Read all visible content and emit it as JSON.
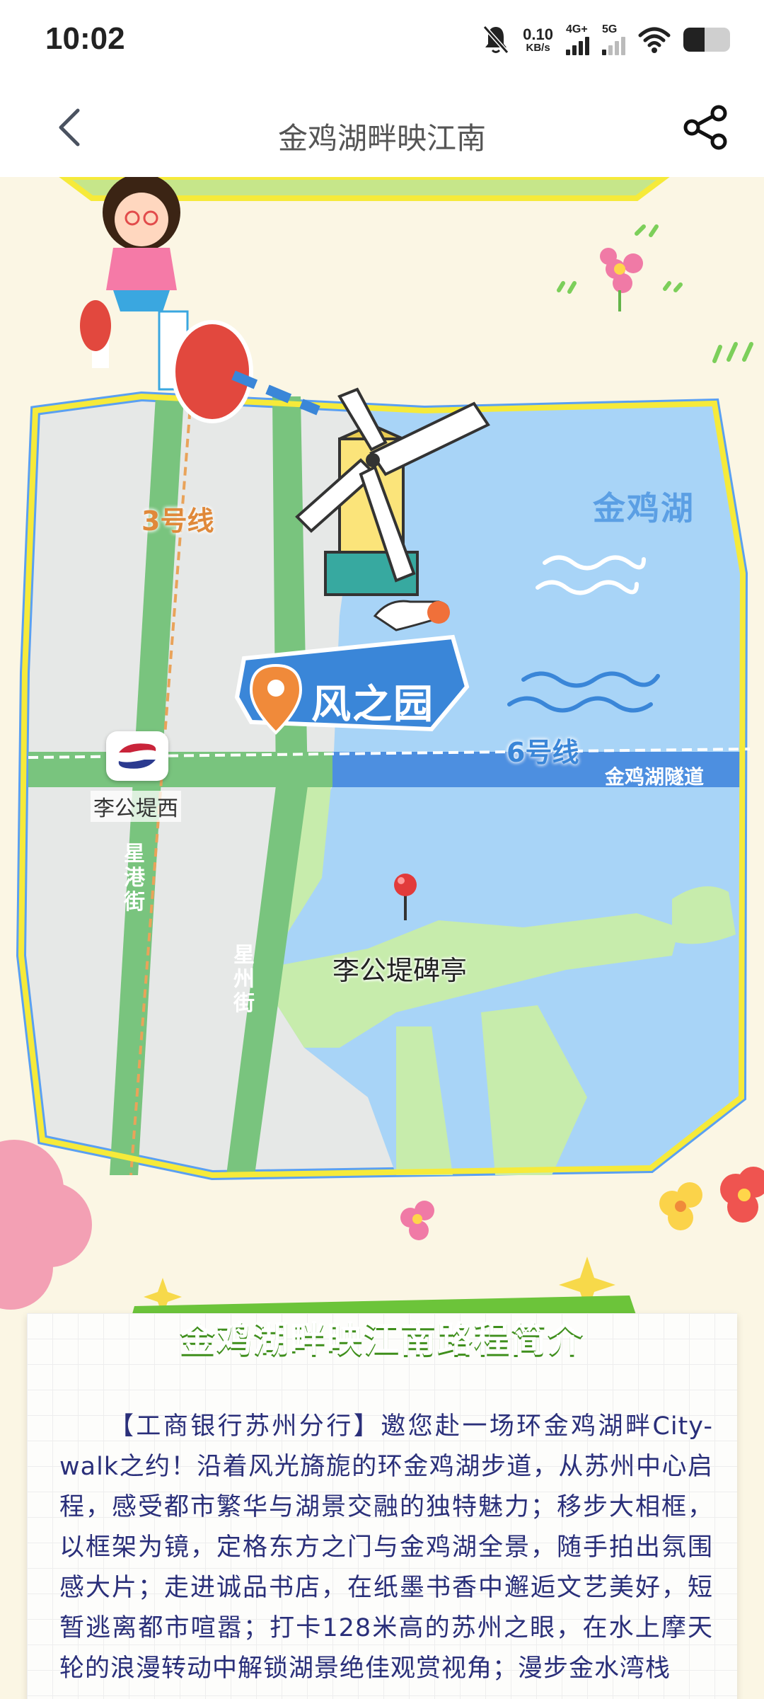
{
  "status_bar": {
    "time": "10:02",
    "net_speed_value": "0.10",
    "net_speed_unit": "KB/s",
    "signal_1_label": "4G+",
    "signal_2_label": "5G",
    "battery_level": 0.45
  },
  "nav": {
    "title": "金鸡湖畔映江南",
    "back_icon": "chevron-left-icon",
    "share_icon": "share-icon"
  },
  "map": {
    "line3_label": "3号线",
    "line6_label": "6号线",
    "tunnel_label": "金鸡湖隧道",
    "lake_label": "金鸡湖",
    "station_label": "李公堤西",
    "street_xinggang": "星港街",
    "street_xingzhou": "星州街",
    "pavilion_label": "李公堤碑亭",
    "landmark_label": "风之园",
    "colors": {
      "lake": "#a8d4f7",
      "road": "#79c47e",
      "land": "#e6e8e7",
      "border": "#f6ea3a",
      "tunnel": "#4d8fe0",
      "pin": "#e23b3b"
    }
  },
  "intro": {
    "heading": "金鸡湖畔映江南路程简介",
    "body": "【工商银行苏州分行】邀您赴一场环金鸡湖畔City-walk之约！沿着风光旖旎的环金鸡湖步道，从苏州中心启程，感受都市繁华与湖景交融的独特魅力；移步大相框，以框架为镜，定格东方之门与金鸡湖全景，随手拍出氛围感大片；走进诚品书店，在纸墨书香中邂逅文艺美好，短暂逃离都市喧嚣；打卡128米高的苏州之眼，在水上摩天轮的浪漫转动中解锁湖景绝佳观赏视角；漫步金水湾栈"
  }
}
